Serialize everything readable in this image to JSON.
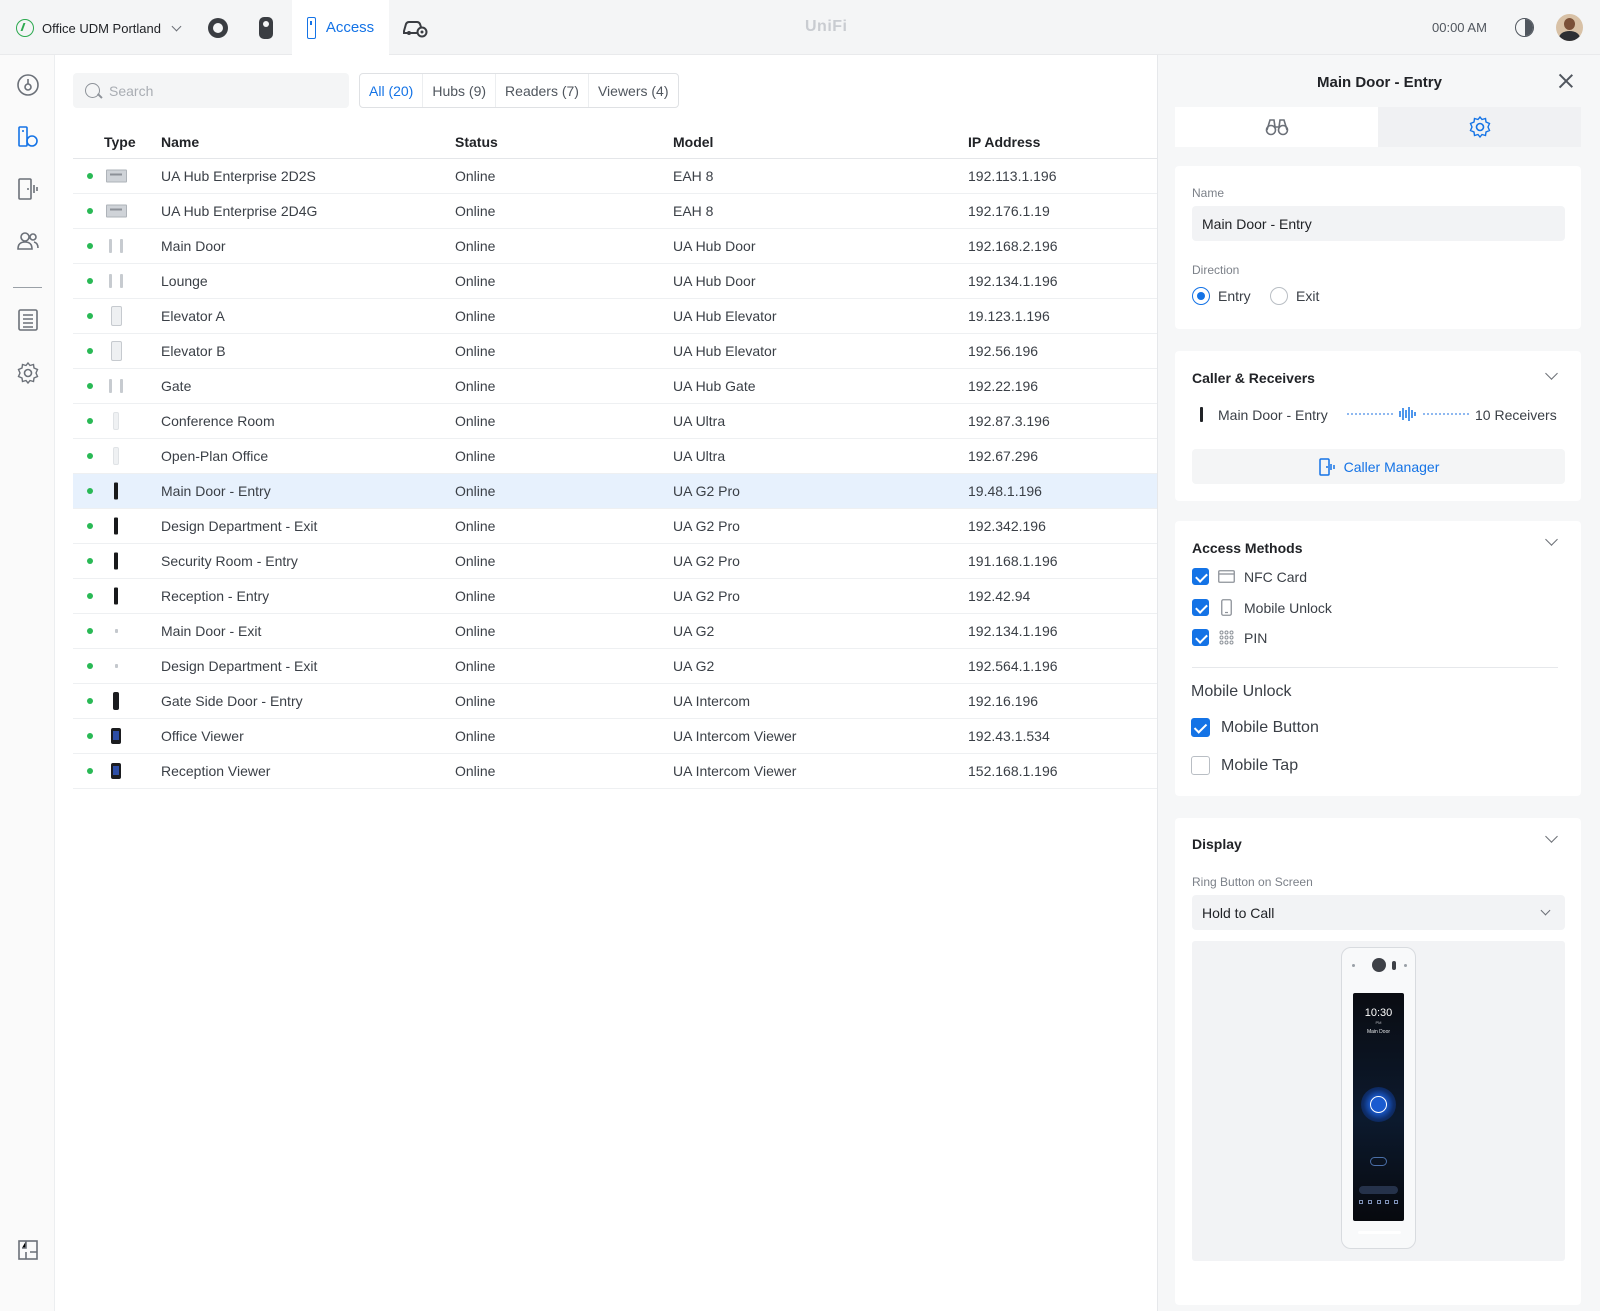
{
  "topbar": {
    "site_name": "Office UDM Portland",
    "active_app_label": "Access",
    "logo_text": "UniFi",
    "clock": "00:00 AM",
    "apps": [
      "protect-icon",
      "talk-icon",
      "access-icon",
      "connect-icon"
    ]
  },
  "sidebar": {
    "items": [
      "dashboard-icon",
      "devices-icon",
      "door-icon",
      "users-icon",
      "logs-icon",
      "settings-icon",
      "floorplan-icon"
    ]
  },
  "main": {
    "search_placeholder": "Search",
    "filters": [
      "All (20)",
      "Hubs (9)",
      "Readers (7)",
      "Viewers (4)"
    ],
    "active_filter": "All (20)",
    "columns": [
      "Type",
      "Name",
      "Status",
      "Model",
      "IP Address"
    ],
    "rows": [
      {
        "type": "hub",
        "name": "UA Hub Enterprise 2D2S",
        "status": "Online",
        "model": "EAH 8",
        "ip": "192.113.1.196"
      },
      {
        "type": "hub",
        "name": "UA Hub Enterprise 2D4G",
        "status": "Online",
        "model": "EAH 8",
        "ip": "192.176.1.19"
      },
      {
        "type": "door",
        "name": "Main Door",
        "status": "Online",
        "model": "UA Hub Door",
        "ip": "192.168.2.196"
      },
      {
        "type": "door",
        "name": "Lounge",
        "status": "Online",
        "model": "UA Hub Door",
        "ip": "192.134.1.196"
      },
      {
        "type": "elev",
        "name": "Elevator A",
        "status": "Online",
        "model": "UA Hub Elevator",
        "ip": "19.123.1.196"
      },
      {
        "type": "elev",
        "name": "Elevator B",
        "status": "Online",
        "model": "UA Hub Elevator",
        "ip": "192.56.196"
      },
      {
        "type": "door",
        "name": "Gate",
        "status": "Online",
        "model": "UA Hub Gate",
        "ip": "192.22.196"
      },
      {
        "type": "ultra",
        "name": "Conference Room",
        "status": "Online",
        "model": "UA Ultra",
        "ip": "192.87.3.196"
      },
      {
        "type": "ultra",
        "name": "Open-Plan Office",
        "status": "Online",
        "model": "UA Ultra",
        "ip": "192.67.296"
      },
      {
        "type": "pro",
        "name": "Main Door - Entry",
        "status": "Online",
        "model": "UA G2 Pro",
        "ip": "19.48.1.196",
        "selected": true
      },
      {
        "type": "pro",
        "name": "Design Department - Exit",
        "status": "Online",
        "model": "UA G2 Pro",
        "ip": "192.342.196"
      },
      {
        "type": "pro",
        "name": "Security Room - Entry",
        "status": "Online",
        "model": "UA G2 Pro",
        "ip": "191.168.1.196"
      },
      {
        "type": "pro",
        "name": "Reception - Entry",
        "status": "Online",
        "model": "UA G2 Pro",
        "ip": "192.42.94"
      },
      {
        "type": "g2",
        "name": "Main Door - Exit",
        "status": "Online",
        "model": "UA G2",
        "ip": "192.134.1.196"
      },
      {
        "type": "g2",
        "name": "Design Department - Exit",
        "status": "Online",
        "model": "UA G2",
        "ip": "192.564.1.196"
      },
      {
        "type": "intercom",
        "name": "Gate Side Door - Entry",
        "status": "Online",
        "model": "UA Intercom",
        "ip": "192.16.196"
      },
      {
        "type": "viewer",
        "name": "Office Viewer",
        "status": "Online",
        "model": "UA Intercom Viewer",
        "ip": "192.43.1.534"
      },
      {
        "type": "viewer",
        "name": "Reception Viewer",
        "status": "Online",
        "model": "UA Intercom Viewer",
        "ip": "152.168.1.196"
      }
    ]
  },
  "panel": {
    "title": "Main Door - Entry",
    "tabs": [
      "binoculars-icon",
      "gear-icon"
    ],
    "active_tab": "gear-icon",
    "name_label": "Name",
    "name_value": "Main Door - Entry",
    "direction_label": "Direction",
    "direction_options": [
      "Entry",
      "Exit"
    ],
    "direction_selected": "Entry",
    "caller": {
      "title": "Caller & Receivers",
      "device": "Main Door - Entry",
      "receivers": "10 Receivers",
      "button": "Caller Manager"
    },
    "access": {
      "title": "Access Methods",
      "methods": [
        {
          "label": "NFC Card",
          "checked": true,
          "icon": "card-icon"
        },
        {
          "label": "Mobile Unlock",
          "checked": true,
          "icon": "phone-icon"
        },
        {
          "label": "PIN",
          "checked": true,
          "icon": "keypad-icon"
        }
      ],
      "mobile_title": "Mobile Unlock",
      "mobile_options": [
        {
          "label": "Mobile Button",
          "checked": true
        },
        {
          "label": "Mobile Tap",
          "checked": false
        }
      ]
    },
    "display": {
      "title": "Display",
      "ring_label": "Ring Button on Screen",
      "ring_value": "Hold to Call",
      "preview_time": "10:30",
      "preview_ampm": "PM",
      "preview_door": "Main Door"
    }
  },
  "colors": {
    "accent": "#1473e6",
    "online": "#29b955",
    "selected_row": "#e7f1fd"
  }
}
